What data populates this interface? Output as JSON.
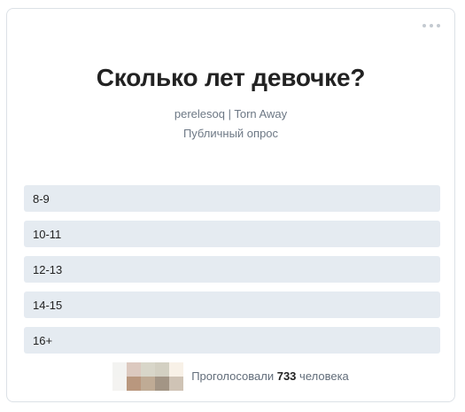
{
  "poll": {
    "title": "Сколько лет девочке?",
    "author": "perelesoq | Torn Away",
    "type": "Публичный опрос",
    "options": [
      {
        "label": "8-9"
      },
      {
        "label": "10-11"
      },
      {
        "label": "12-13"
      },
      {
        "label": "14-15"
      },
      {
        "label": "16+"
      }
    ],
    "footer": {
      "prefix": "Проголосовали",
      "count": "733",
      "suffix": "человека"
    }
  },
  "icons": {
    "more": "more-horizontal-icon"
  },
  "colors": {
    "option_background": "#e5ebf1",
    "card_border": "#dce1e6",
    "secondary_text": "#6d7885"
  }
}
